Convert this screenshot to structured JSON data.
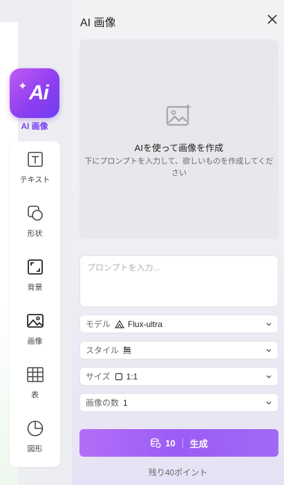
{
  "sidebar": {
    "ai_image": {
      "icon_text": "Ai",
      "label": "AI 画像"
    },
    "tools": [
      {
        "label": "テキスト",
        "icon": "text-icon"
      },
      {
        "label": "形状",
        "icon": "shape-icon"
      },
      {
        "label": "背景",
        "icon": "background-icon"
      },
      {
        "label": "画像",
        "icon": "image-icon"
      },
      {
        "label": "表",
        "icon": "table-icon"
      },
      {
        "label": "図形",
        "icon": "chart-icon"
      }
    ]
  },
  "panel": {
    "title": "AI 画像",
    "preview": {
      "title": "AIを使って画像を作成",
      "description": "下にプロンプトを入力して、欲しいものを作成してください"
    },
    "prompt": {
      "placeholder": "プロンプトを入力..."
    },
    "model": {
      "label": "モデル",
      "value": "Flux-ultra"
    },
    "style": {
      "label": "スタイル",
      "value": "無"
    },
    "size": {
      "label": "サイズ",
      "value": "1:1"
    },
    "count": {
      "label": "画像の数",
      "value": "1"
    },
    "generate": {
      "cost": "10",
      "label": "生成"
    },
    "remaining": "残り40ポイント"
  },
  "colors": {
    "accent": "#8f3ff0",
    "button": "#a065f5"
  }
}
